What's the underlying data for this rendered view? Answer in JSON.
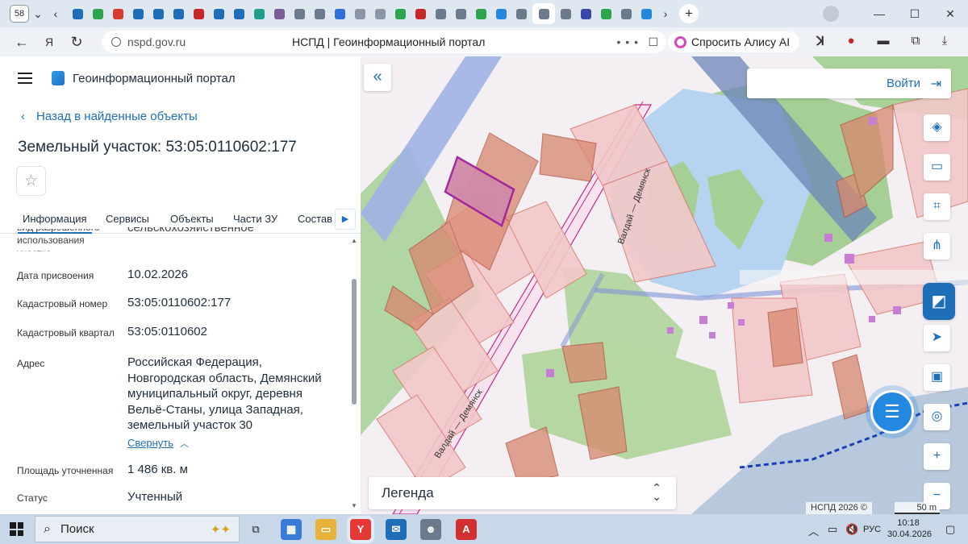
{
  "browser": {
    "tab_count": "58",
    "url_host": "nspd.gov.ru",
    "page_title": "НСПД | Геоинформационный портал",
    "alice_label": "Спросить Алису AI",
    "tab_favicons": [
      "#1f6fb8",
      "#2da44e",
      "#d63b2f",
      "#1f6fb8",
      "#1f6fb8",
      "#1f6fb8",
      "#c62828",
      "#1f6fb8",
      "#1f6fb8",
      "#1f9e8a",
      "#7a5c9a",
      "#6b7a8c",
      "#6b7a8c",
      "#2f6fd6",
      "#8a96a6",
      "#8a96a6",
      "#2da44e",
      "#c62828",
      "#6b7a8c",
      "#6b7a8c",
      "#2da44e",
      "#2389e0",
      "#6b7a8c",
      "#6b7a8c",
      "#6b7a8c",
      "#3949ab",
      "#2da44e",
      "#6b7a8c",
      "#2389e0"
    ]
  },
  "panel": {
    "portal_name": "Геоинформационный портал",
    "back_link": "Назад в найденные объекты",
    "object_title": "Земельный участок: 53:05:0110602:177",
    "tabs": [
      "Информация",
      "Сервисы",
      "Объекты",
      "Части ЗУ",
      "Состав"
    ],
    "cut_label": "вид разрешенного использования участка",
    "cut_value": "сельскохозяйственное",
    "rows": [
      {
        "label": "Дата присвоения",
        "value": "10.02.2026"
      },
      {
        "label": "Кадастровый номер",
        "value": "53:05:0110602:177"
      },
      {
        "label": "Кадастровый квартал",
        "value": "53:05:0110602"
      },
      {
        "label": "Адрес",
        "value": "Российская Федерация, Новгородская область, Демянский муниципальный округ, деревня Вельё-Станы, улица Западная, земельный участок 30"
      },
      {
        "label": "Площадь уточненная",
        "value": "1 486 кв. м"
      },
      {
        "label": "Статус",
        "value": "Учтенный"
      }
    ],
    "collapse_link": "Свернуть"
  },
  "map": {
    "login_label": "Войти",
    "legend_label": "Легенда",
    "attribution": "НСПД 2026 ©",
    "scale_label": "50 m",
    "road_label": "Валдай — Демянск",
    "tools": [
      "layers-icon",
      "ruler-icon",
      "scan-icon",
      "share-icon",
      "map-logo-icon",
      "navigate-icon",
      "minimap-icon",
      "locate-icon",
      "zoom-in-icon",
      "zoom-out-icon"
    ]
  },
  "taskbar": {
    "search_placeholder": "Поиск",
    "language": "РУС",
    "time": "10:18",
    "date": "30.04.2026"
  }
}
